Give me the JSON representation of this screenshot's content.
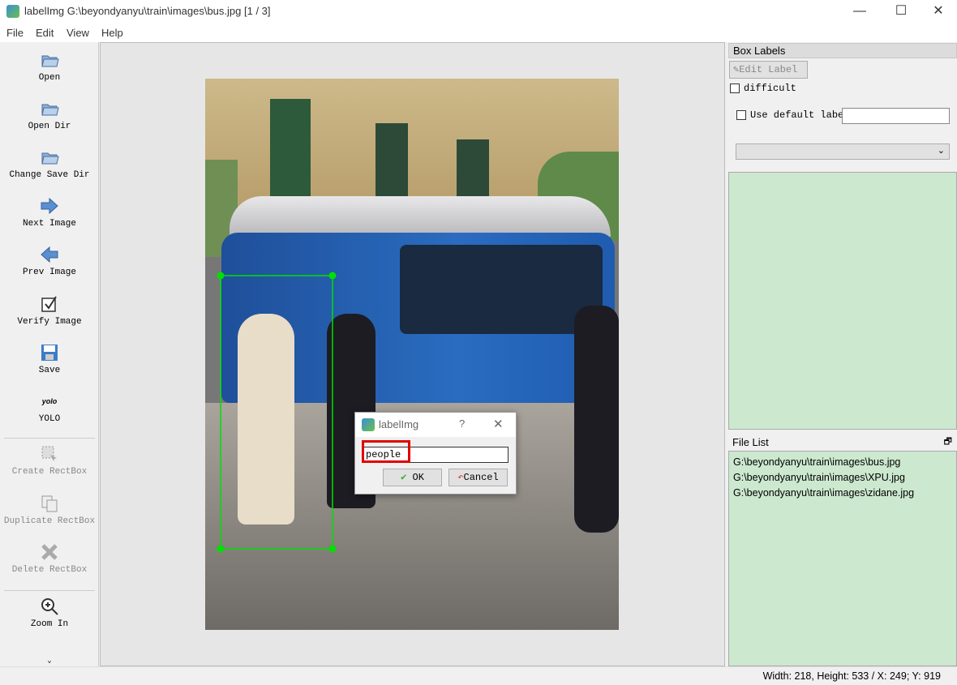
{
  "window": {
    "title": "labelImg G:\\beyondyanyu\\train\\images\\bus.jpg [1 / 3]",
    "controls": [
      "minimize",
      "maximize",
      "close"
    ]
  },
  "menu": [
    {
      "label": "File"
    },
    {
      "label": "Edit"
    },
    {
      "label": "View"
    },
    {
      "label": "Help"
    }
  ],
  "toolbar": [
    {
      "label": "Open",
      "icon": "folder-icon",
      "enabled": true
    },
    {
      "label": "Open Dir",
      "icon": "folder-icon",
      "enabled": true
    },
    {
      "label": "Change Save Dir",
      "icon": "folder-icon",
      "enabled": true
    },
    {
      "label": "Next Image",
      "icon": "arrow-right-icon",
      "enabled": true
    },
    {
      "label": "Prev Image",
      "icon": "arrow-left-icon",
      "enabled": true
    },
    {
      "label": "Verify Image",
      "icon": "checkbox-icon",
      "enabled": true
    },
    {
      "label": "Save",
      "icon": "floppy-icon",
      "enabled": true
    },
    {
      "label": "YOLO",
      "icon": "yolo-icon",
      "icon_text": "yolo",
      "enabled": true
    },
    {
      "label": "Create RectBox",
      "icon": "rect-draw-icon",
      "enabled": false
    },
    {
      "label": "Duplicate RectBox",
      "icon": "copy-icon",
      "enabled": false
    },
    {
      "label": "Delete RectBox",
      "icon": "delete-icon",
      "enabled": false
    },
    {
      "label": "Zoom In",
      "icon": "zoom-in-icon",
      "enabled": true
    }
  ],
  "dialog": {
    "title": "labelImg",
    "help": "?",
    "input_value": "people",
    "ok": "OK",
    "cancel": "Cancel"
  },
  "box_labels": {
    "title": "Box Labels",
    "edit_label": "Edit Label",
    "difficult": "difficult",
    "use_default": "Use default label",
    "default_value": ""
  },
  "file_list": {
    "title": "File List",
    "files": [
      "G:\\beyondyanyu\\train\\images\\bus.jpg",
      "G:\\beyondyanyu\\train\\images\\XPU.jpg",
      "G:\\beyondyanyu\\train\\images\\zidane.jpg"
    ]
  },
  "status": "Width: 218, Height: 533 / X: 249; Y: 919",
  "colors": {
    "bbox": "#00e000",
    "highlight": "#e00000",
    "list_bg": "#cce8cf"
  }
}
